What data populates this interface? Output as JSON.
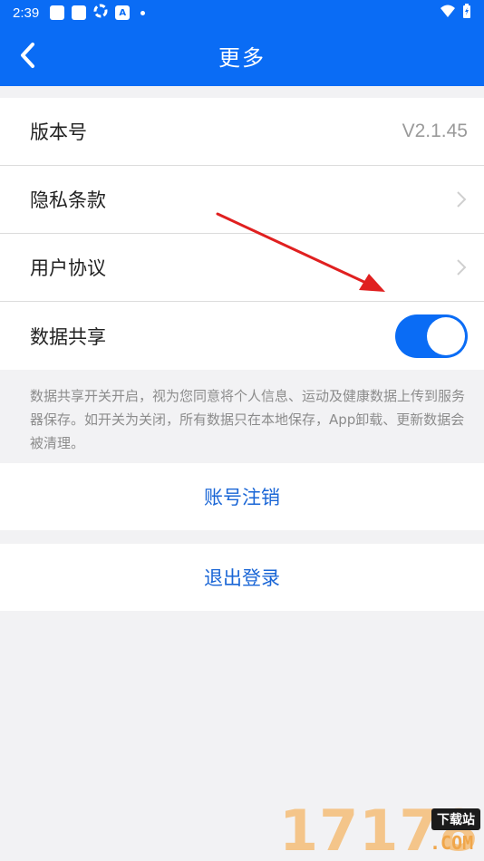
{
  "status_bar": {
    "time": "2:39",
    "notification_icons": [
      "app-icon",
      "app-icon",
      "sync-icon",
      "a-icon"
    ]
  },
  "header": {
    "title": "更多",
    "background_color": "#0a6cf5"
  },
  "settings": {
    "version_label": "版本号",
    "version_value": "V2.1.45",
    "privacy_label": "隐私条款",
    "agreement_label": "用户协议",
    "data_share_label": "数据共享",
    "data_share_enabled": true
  },
  "note": "数据共享开关开启，视为您同意将个人信息、运动及健康数据上传到服务器保存。如开关为关闭，所有数据只在本地保存，App卸载、更新数据会被清理。",
  "actions": {
    "cancel_account": "账号注销",
    "logout": "退出登录"
  },
  "watermark": {
    "digits": "17178",
    "badge": "下载站",
    "domain": ".COM"
  },
  "colors": {
    "accent": "#0a6cf5",
    "link": "#1a66d6",
    "annotation_arrow": "#e02020"
  }
}
